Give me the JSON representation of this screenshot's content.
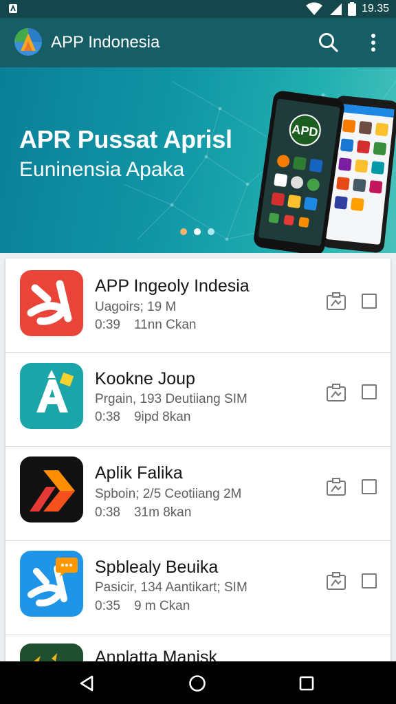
{
  "status_bar": {
    "time": "19.35",
    "icons": [
      "notification-icon",
      "wifi-icon",
      "cell-signal-icon",
      "battery-icon"
    ]
  },
  "app_bar": {
    "title": "APP Indonesia",
    "actions": [
      "search-icon",
      "more-vert-icon"
    ]
  },
  "banner": {
    "title": "APR Pussat Aprisl",
    "subtitle": "Euninensia Apaka",
    "phone_badge": "APD",
    "carousel_pages": 3,
    "carousel_active": 1
  },
  "apps": [
    {
      "name": "APP Ingeoly Indesia",
      "meta": "Uagoirs; 19 M",
      "time": "0:39",
      "size": "11nn Ckan",
      "icon": "scissors-logo-icon",
      "color": "#e94438",
      "checked": false
    },
    {
      "name": "Kookne  Joup",
      "meta": "Prgain, 193 Deutiiang SIM",
      "time": "0:38",
      "size": "9ipd 8kan",
      "icon": "letter-a-logo-icon",
      "color": "#1ba5a8",
      "checked": false
    },
    {
      "name": "Aplik Falika",
      "meta": "Spboin; 2/5 Ceotiiang 2M",
      "time": "0:38",
      "size": "31m 8kan",
      "icon": "chevron-logo-icon",
      "color": "#111111",
      "checked": false
    },
    {
      "name": "Spblealy Beuika",
      "meta": "Pasicir, 134 Aantikart; SIM",
      "time": "0:35",
      "size": "9 m Ckan",
      "icon": "chat-scissors-logo-icon",
      "color": "#1e95e6",
      "checked": false
    },
    {
      "name": "Anplatta Manisk",
      "meta": "",
      "time": "",
      "size": "",
      "icon": "plant-logo-icon",
      "color": "#1f4f2e",
      "checked": false
    }
  ],
  "nav_bar": {
    "buttons": [
      "back-icon",
      "home-icon",
      "recent-apps-icon"
    ]
  },
  "colors": {
    "status_bar": "#14474c",
    "app_bar": "#175d66",
    "banner_start": "#0a7f98",
    "banner_end": "#49c2bb"
  }
}
